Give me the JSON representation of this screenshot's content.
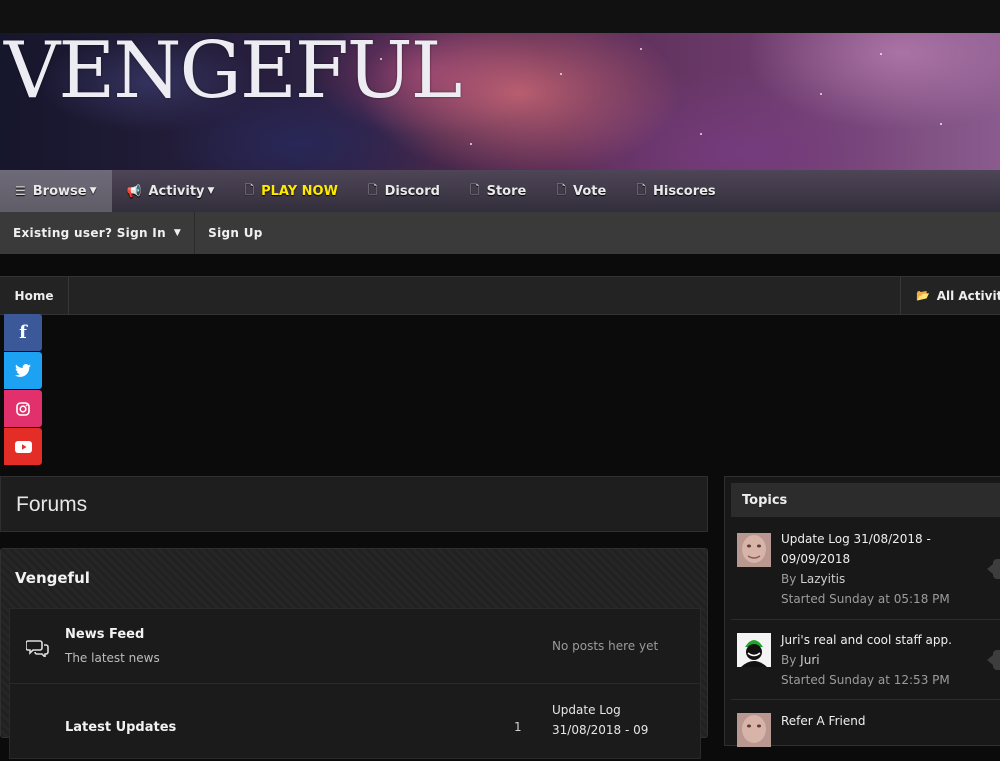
{
  "site": {
    "logo_text": "VENGEFUL"
  },
  "nav": {
    "items": [
      {
        "label": "Browse",
        "icon": "list-icon",
        "dropdown": true,
        "active": true
      },
      {
        "label": "Activity",
        "icon": "megaphone-icon",
        "dropdown": true
      },
      {
        "label": "PLAY NOW",
        "icon": "page-icon",
        "highlight_color": "#ffea00"
      },
      {
        "label": "Discord",
        "icon": "page-icon"
      },
      {
        "label": "Store",
        "icon": "page-icon"
      },
      {
        "label": "Vote",
        "icon": "page-icon"
      },
      {
        "label": "Hiscores",
        "icon": "page-icon"
      }
    ]
  },
  "userbar": {
    "signin_label": "Existing user? Sign In",
    "signup_label": "Sign Up"
  },
  "breadcrumb": {
    "home": "Home",
    "all_activity": "All Activity"
  },
  "social": {
    "items": [
      {
        "name": "facebook",
        "glyph": "f",
        "color": "#3b5998"
      },
      {
        "name": "twitter",
        "glyph": "🐦",
        "color": "#1da1f2"
      },
      {
        "name": "instagram",
        "glyph": "",
        "color": "#e1306c"
      },
      {
        "name": "youtube",
        "glyph": "",
        "color": "#e52d27"
      }
    ]
  },
  "forums": {
    "title": "Forums",
    "category": "Vengeful",
    "rows": [
      {
        "name": "News Feed",
        "description": "The latest news",
        "last_post": "No posts here yet"
      },
      {
        "name": "Latest Updates",
        "count": "1",
        "last_post": "Update Log 31/08/2018 - 09"
      }
    ]
  },
  "sidebar": {
    "title": "Topics",
    "topics": [
      {
        "title": "Update Log 31/08/2018 - 09/09/2018",
        "by_prefix": "By",
        "author": "Lazyitis",
        "started_prefix": "Started",
        "started": "Sunday at 05:18 PM"
      },
      {
        "title": "Juri's real and cool staff app.",
        "by_prefix": "By",
        "author": "Juri",
        "started_prefix": "Started",
        "started": "Sunday at 12:53 PM"
      },
      {
        "title": "Refer A Friend"
      }
    ]
  }
}
